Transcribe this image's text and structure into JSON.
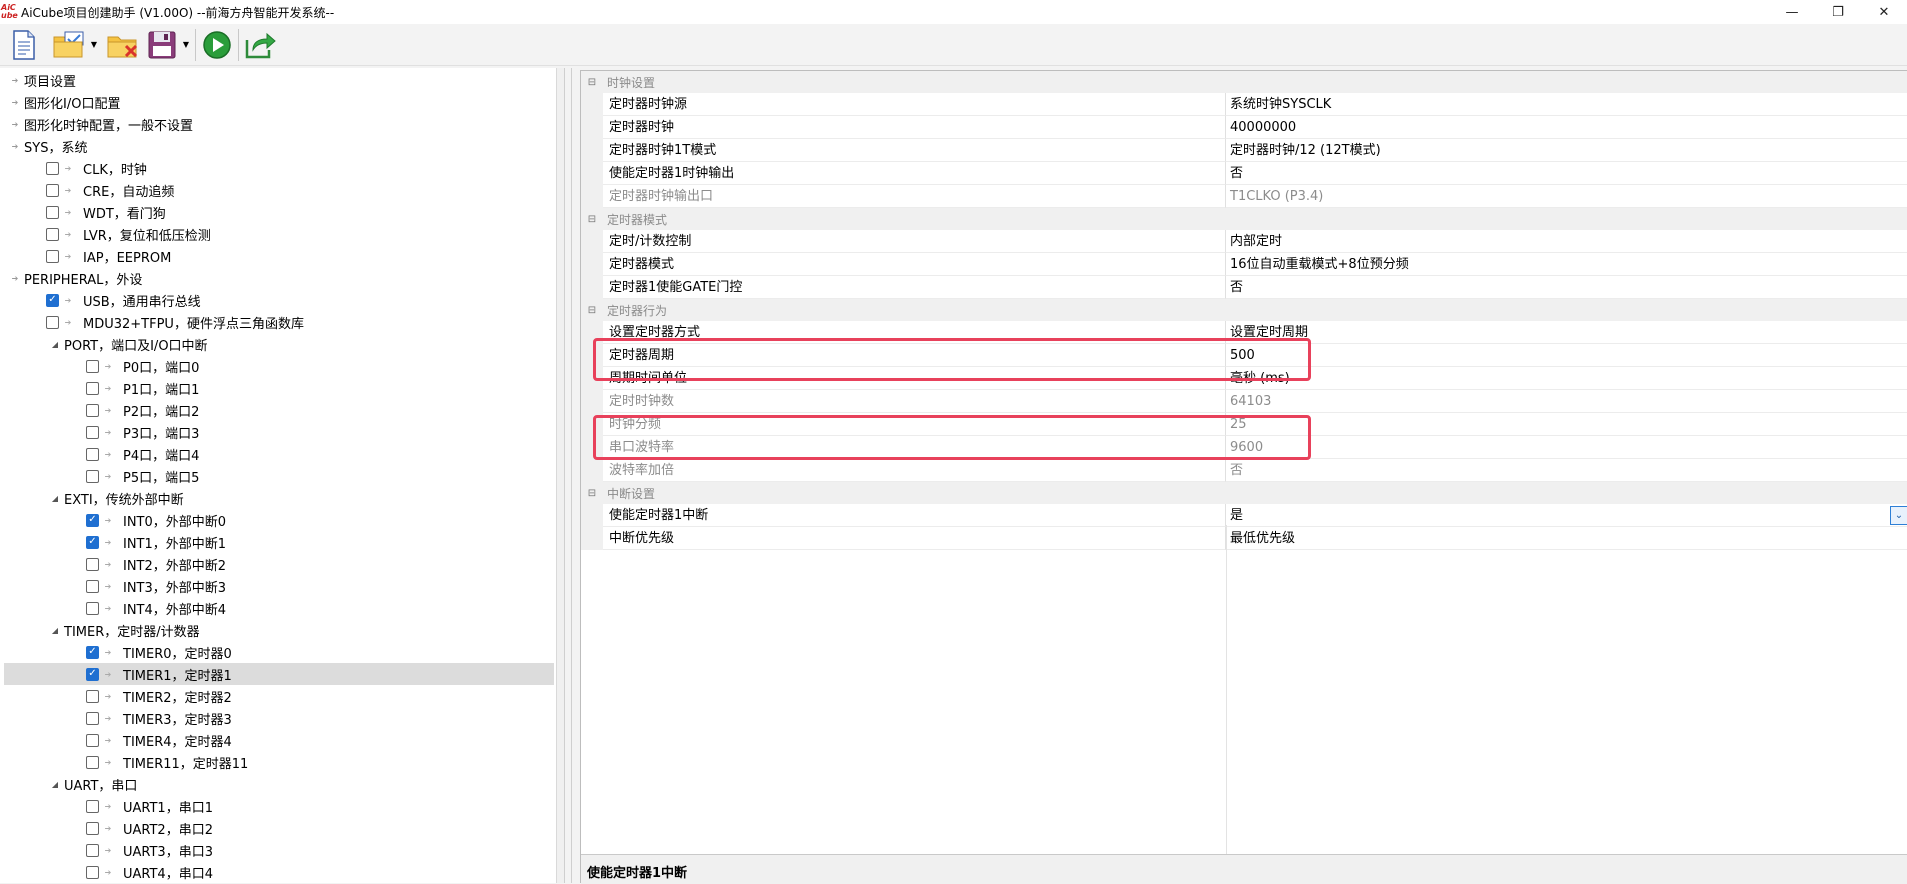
{
  "window": {
    "title": "AiCube项目创建助手 (V1.00O) --前海方舟智能开发系统--",
    "logo_text": "AiC Cube",
    "controls": [
      "—",
      "❐",
      "✕"
    ]
  },
  "toolbar": {
    "buttons": [
      "new-file-icon",
      "open-project-icon",
      "close-project-icon",
      "save-icon",
      "run-icon",
      "export-icon"
    ]
  },
  "tree": {
    "items": [
      {
        "label": "项目设置"
      },
      {
        "label": "图形化I/O口配置"
      },
      {
        "label": "图形化时钟配置，一般不设置"
      },
      {
        "label": "SYS，系统"
      },
      {
        "label": "CLK，时钟"
      },
      {
        "label": "CRE，自动追频"
      },
      {
        "label": "WDT，看门狗"
      },
      {
        "label": "LVR，复位和低压检测"
      },
      {
        "label": "IAP，EEPROM"
      },
      {
        "label": "PERIPHERAL，外设"
      },
      {
        "label": "USB，通用串行总线"
      },
      {
        "label": "MDU32+TFPU，硬件浮点三角函数库"
      },
      {
        "label": "PORT，端口及I/O口中断"
      },
      {
        "label": "P0口，端口0"
      },
      {
        "label": "P1口，端口1"
      },
      {
        "label": "P2口，端口2"
      },
      {
        "label": "P3口，端口3"
      },
      {
        "label": "P4口，端口4"
      },
      {
        "label": "P5口，端口5"
      },
      {
        "label": "EXTI，传统外部中断"
      },
      {
        "label": "INT0，外部中断0"
      },
      {
        "label": "INT1，外部中断1"
      },
      {
        "label": "INT2，外部中断2"
      },
      {
        "label": "INT3，外部中断3"
      },
      {
        "label": "INT4，外部中断4"
      },
      {
        "label": "TIMER，定时器/计数器"
      },
      {
        "label": "TIMER0，定时器0"
      },
      {
        "label": "TIMER1，定时器1"
      },
      {
        "label": "TIMER2，定时器2"
      },
      {
        "label": "TIMER3，定时器3"
      },
      {
        "label": "TIMER4，定时器4"
      },
      {
        "label": "TIMER11，定时器11"
      },
      {
        "label": "UART，串口"
      },
      {
        "label": "UART1，串口1"
      },
      {
        "label": "UART2，串口2"
      },
      {
        "label": "UART3，串口3"
      },
      {
        "label": "UART4，串口4"
      }
    ]
  },
  "properties": {
    "categories": [
      {
        "name": "时钟设置"
      },
      {
        "name": "定时器模式"
      },
      {
        "name": "定时器行为"
      },
      {
        "name": "中断设置"
      }
    ],
    "rows": [
      {
        "name": "定时器时钟源",
        "value": "系统时钟SYSCLK"
      },
      {
        "name": "定时器时钟",
        "value": "40000000"
      },
      {
        "name": "定时器时钟1T模式",
        "value": "定时器时钟/12 (12T模式)"
      },
      {
        "name": "使能定时器1时钟输出",
        "value": "否"
      },
      {
        "name": "定时器时钟输出口",
        "value": "T1CLKO (P3.4)"
      },
      {
        "name": "定时/计数控制",
        "value": "内部定时"
      },
      {
        "name": "定时器模式",
        "value": "16位自动重载模式+8位预分频"
      },
      {
        "name": "定时器1使能GATE门控",
        "value": "否"
      },
      {
        "name": "设置定时器方式",
        "value": "设置定时周期"
      },
      {
        "name": "定时器周期",
        "value": "500"
      },
      {
        "name": "周期时间单位",
        "value": "毫秒 (ms)"
      },
      {
        "name": "定时时钟数",
        "value": "64103"
      },
      {
        "name": "时钟分频",
        "value": "25"
      },
      {
        "name": "串口波特率",
        "value": "9600"
      },
      {
        "name": "波特率加倍",
        "value": "否"
      },
      {
        "name": "使能定时器1中断",
        "value": "是"
      },
      {
        "name": "中断优先级",
        "value": "最低优先级"
      }
    ],
    "description": "使能定时器1中断"
  }
}
